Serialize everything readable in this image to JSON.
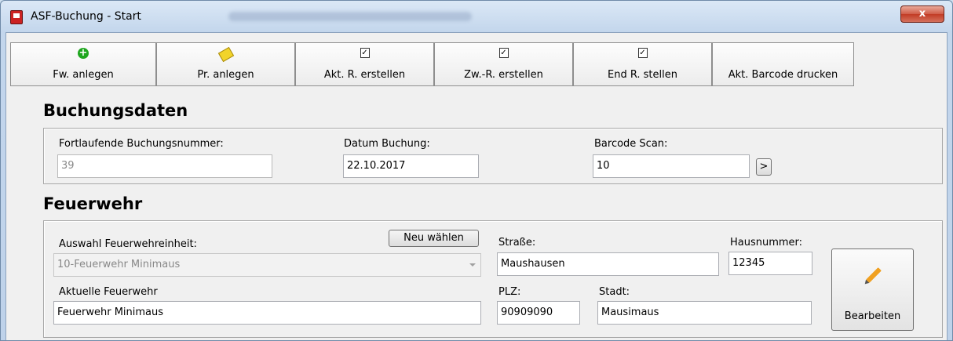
{
  "window": {
    "title": "ASF-Buchung - Start",
    "close_label": "x"
  },
  "toolbar": {
    "buttons": [
      {
        "label": "Fw. anlegen",
        "icon": "plus-circle-icon"
      },
      {
        "label": "Pr. anlegen",
        "icon": "note-icon"
      },
      {
        "label": "Akt. R. erstellen",
        "icon": "checkbox-icon"
      },
      {
        "label": "Zw.-R. erstellen",
        "icon": "checkbox-icon"
      },
      {
        "label": "End R. stellen",
        "icon": "checkbox-icon"
      },
      {
        "label": "Akt. Barcode drucken",
        "icon": ""
      }
    ]
  },
  "buchungsdaten": {
    "title": "Buchungsdaten",
    "buchungsnummer": {
      "label": "Fortlaufende Buchungsnummer:",
      "value": "39"
    },
    "datum": {
      "label": "Datum Buchung:",
      "value": "22.10.2017"
    },
    "barcode": {
      "label": "Barcode Scan:",
      "value": "10",
      "button": ">"
    }
  },
  "feuerwehr": {
    "title": "Feuerwehr",
    "auswahl": {
      "label": "Auswahl Feuerwehreinheit:",
      "value": "10-Feuerwehr Minimaus",
      "button": "Neu wählen"
    },
    "aktuelle": {
      "label": "Aktuelle Feuerwehr",
      "value": "Feuerwehr Minimaus"
    },
    "strasse": {
      "label": "Straße:",
      "value": "Maushausen"
    },
    "hausnummer": {
      "label": "Hausnummer:",
      "value": "12345"
    },
    "plz": {
      "label": "PLZ:",
      "value": "90909090"
    },
    "stadt": {
      "label": "Stadt:",
      "value": "Mausimaus"
    },
    "edit_button": "Bearbeiten"
  }
}
